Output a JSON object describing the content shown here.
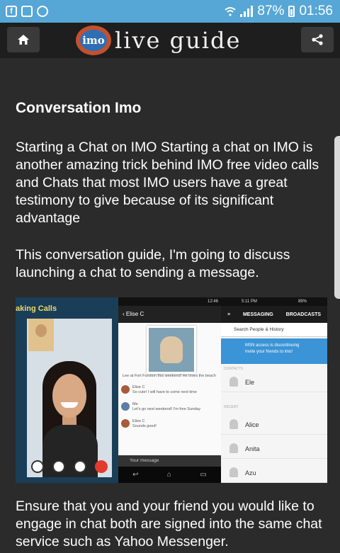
{
  "status_bar": {
    "battery": "87%",
    "time": "01:56",
    "icons": [
      "facebook-icon",
      "gallery-icon",
      "sync-icon",
      "wifi-icon",
      "signal-icon",
      "battery-icon"
    ]
  },
  "header": {
    "logo_badge": "imo",
    "logo_text": "live guide",
    "home_icon": "home-icon",
    "share_icon": "share-icon"
  },
  "article": {
    "title": "Conversation Imo",
    "paragraphs": [
      "Starting a Chat on IMO Starting a chat on IMO is another amazing trick behind IMO free video calls and Chats that most IMO users have a great testimony to give because of its significant advantage",
      "This conversation guide, I'm going to discuss launching a chat to sending a message.",
      "Ensure that you and your friend you would like to engage in chat both are signed into the same chat service such as Yahoo Messenger."
    ]
  },
  "illustration": {
    "panel1": {
      "title": "aking Calls"
    },
    "panel2": {
      "status": "12:46",
      "contact": "Elise C",
      "messages": [
        "Lee at Fort Funston this weekend! He loves the beach",
        "Elise C",
        "So cute! I will have to come next time",
        "Me",
        "Let's go next weekend! I'm free Sunday",
        "Elise C",
        "Sounds good!"
      ],
      "input_placeholder": "Your message"
    },
    "panel3": {
      "status_time": "5:11 PM",
      "status_battery": "89%",
      "tab_messaging": "MESSAGING",
      "tab_broadcasts": "BROADCASTS",
      "search": "Search People & History",
      "promo_line1": "MSN access is discontinuing",
      "promo_line2": "Invite your friends to imo!",
      "section_contacts": "CONTACTS",
      "section_recent": "RECENT",
      "contacts": [
        "Ele",
        "Alice",
        "Anita",
        "Azu"
      ]
    }
  }
}
